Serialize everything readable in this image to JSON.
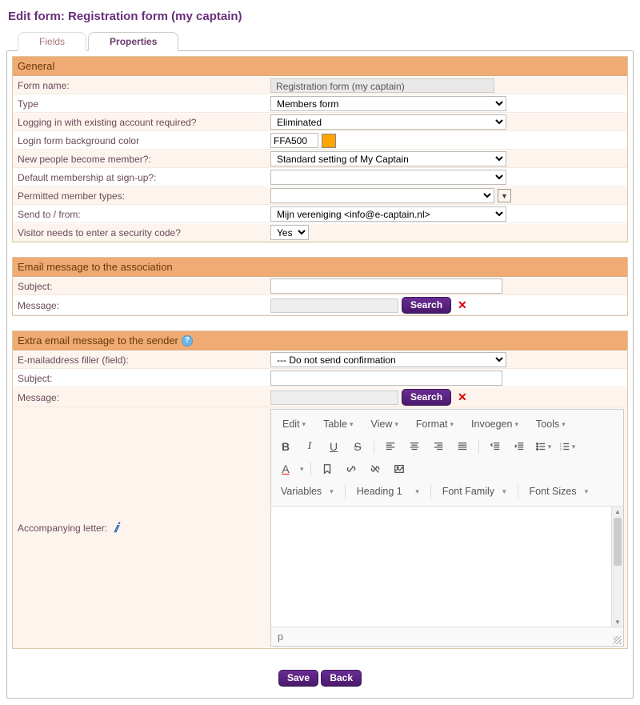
{
  "page_title": "Edit form: Registration form (my captain)",
  "tabs": {
    "fields": "Fields",
    "properties": "Properties",
    "active": "properties"
  },
  "general": {
    "header": "General",
    "form_name_label": "Form name:",
    "form_name_value": "Registration form (my captain)",
    "type_label": "Type",
    "type_value": "Members form",
    "login_required_label": "Logging in with existing account required?",
    "login_required_value": "Eliminated",
    "bg_color_label": "Login form background color",
    "bg_color_value": "FFA500",
    "bg_color_hex": "#FFA500",
    "new_member_label": "New people become member?:",
    "new_member_value": "Standard setting of My Captain",
    "default_membership_label": "Default membership at sign-up?:",
    "default_membership_value": "",
    "permitted_types_label": "Permitted member types:",
    "permitted_types_value": "",
    "send_to_label": "Send to / from:",
    "send_to_value": "Mijn vereniging <info@e-captain.nl>",
    "security_code_label": "Visitor needs to enter a security code?",
    "security_code_value": "Yes"
  },
  "email_assoc": {
    "header": "Email message to the association",
    "subject_label": "Subject:",
    "subject_value": "",
    "message_label": "Message:",
    "search_btn": "Search"
  },
  "email_sender": {
    "header": "Extra email message to the sender",
    "filler_label": "E-mailaddress filler (field):",
    "filler_value": "--- Do not send confirmation",
    "subject_label": "Subject:",
    "subject_value": "",
    "message_label": "Message:",
    "search_btn": "Search",
    "letter_label": "Accompanying letter:"
  },
  "editor": {
    "menus": [
      "Edit",
      "Table",
      "View",
      "Format",
      "Invoegen",
      "Tools"
    ],
    "dropdowns": {
      "variables": "Variables",
      "heading": "Heading 1",
      "font_family": "Font Family",
      "font_sizes": "Font Sizes"
    },
    "status": "p"
  },
  "buttons": {
    "save": "Save",
    "back": "Back"
  }
}
